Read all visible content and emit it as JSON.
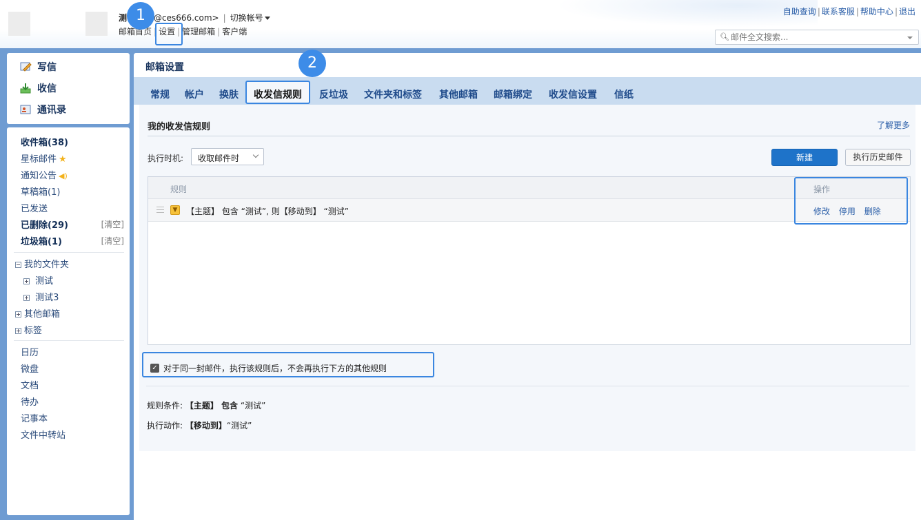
{
  "header": {
    "user_prefix": "测",
    "user_email": "hi@ces666.com>",
    "switch_account": "切换帐号",
    "nav": [
      "邮箱首页",
      "设置",
      "管理邮箱",
      "客户端"
    ],
    "top_links": [
      "自助查询",
      "联系客服",
      "帮助中心",
      "退出"
    ],
    "search_placeholder": "邮件全文搜索..."
  },
  "badges": [
    "1",
    "2"
  ],
  "sidebar": {
    "compose": [
      "写信",
      "收信",
      "通讯录"
    ],
    "folders": [
      {
        "label": "收件箱(38)",
        "bold": true
      },
      {
        "label": "星标邮件"
      },
      {
        "label": "通知公告"
      },
      {
        "label": "草稿箱(1)"
      },
      {
        "label": "已发送"
      },
      {
        "label": "已删除(29)",
        "bold": true,
        "action": "[清空]"
      },
      {
        "label": "垃圾箱(1)",
        "bold": true,
        "action": "[清空]"
      }
    ],
    "my_folders": "我的文件夹",
    "my_folder_items": [
      "测试",
      "测试3"
    ],
    "other_mailbox": "其他邮箱",
    "tags": "标签",
    "tools": [
      "日历",
      "微盘",
      "文档",
      "待办",
      "记事本",
      "文件中转站"
    ]
  },
  "main": {
    "title": "邮箱设置",
    "tabs": [
      "常规",
      "帐户",
      "换肤",
      "收发信规则",
      "反垃圾",
      "文件夹和标签",
      "其他邮箱",
      "邮箱绑定",
      "收发信设置",
      "信纸"
    ],
    "active_tab": "收发信规则",
    "section_title": "我的收发信规则",
    "learn_more": "了解更多",
    "timing_label": "执行时机:",
    "timing_value": "收取邮件时",
    "new_button": "新建",
    "history_button": "执行历史邮件",
    "table": {
      "col_rule": "规则",
      "col_ops": "操作",
      "rule_text": "【主题】 包含 “测试”, 则【移动到】 “测试”",
      "ops": [
        "修改",
        "停用",
        "删除"
      ]
    },
    "stop_checkbox_label": "对于同一封邮件，执行该规则后，不会再执行下方的其他规则",
    "condition_label": "规则条件:",
    "condition_value_bold": "【主题】 包含",
    "condition_value": "“测试”",
    "action_label": "执行动作:",
    "action_value_bold": "【移动到】",
    "action_value": "“测试”"
  }
}
